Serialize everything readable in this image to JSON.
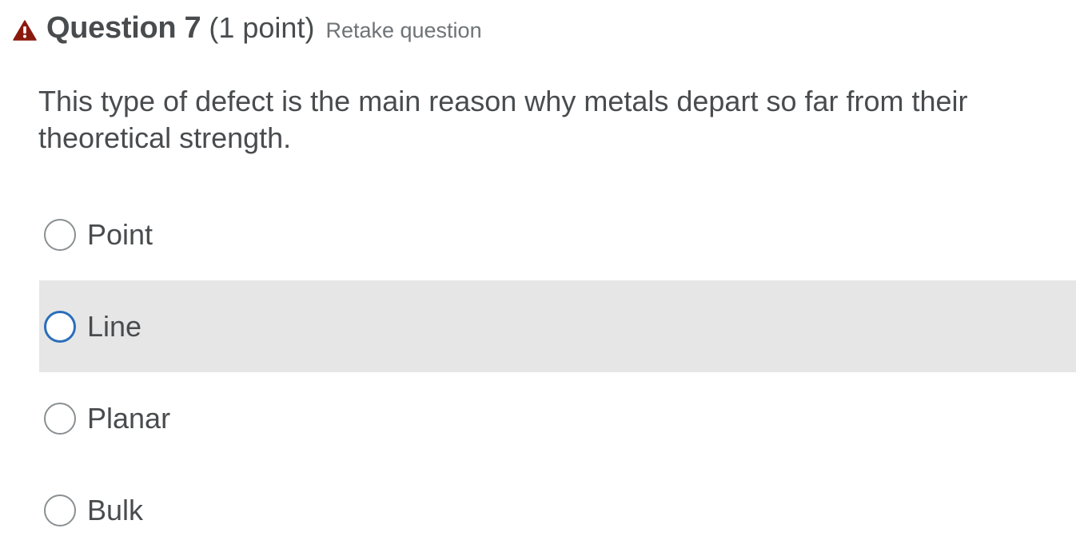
{
  "header": {
    "title": "Question 7",
    "points": "(1 point)",
    "retake_link": "Retake question",
    "warning_icon": "warning-triangle-icon",
    "warning_color": "#8b1a0e"
  },
  "question": {
    "text": "This type of defect is the main reason why metals depart so far from their theoretical strength."
  },
  "options": [
    {
      "label": "Point",
      "state": "default"
    },
    {
      "label": "Line",
      "state": "hover-focus"
    },
    {
      "label": "Planar",
      "state": "default"
    },
    {
      "label": "Bulk",
      "state": "default"
    }
  ],
  "colors": {
    "text": "#494c4e",
    "hover_background": "#e6e6e6",
    "focus_ring": "#2a6ebb",
    "radio_border": "#8a8f92"
  }
}
